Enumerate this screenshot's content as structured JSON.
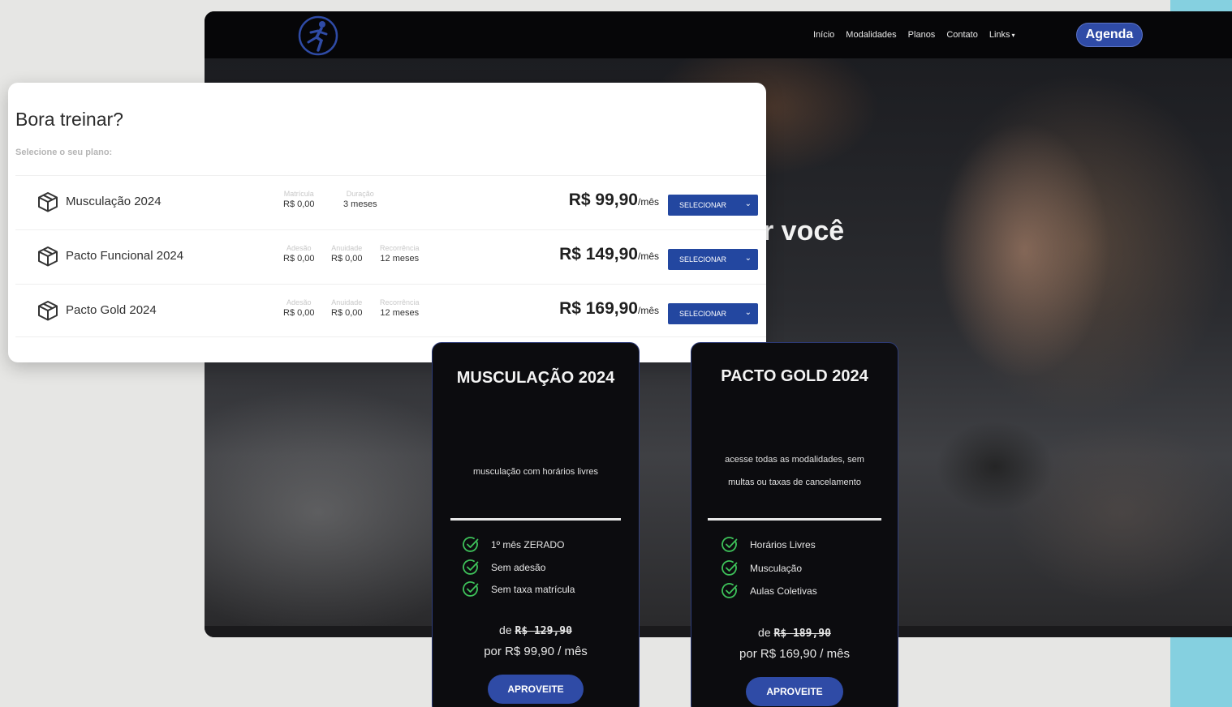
{
  "colors": {
    "brand_blue": "#2f4ba6",
    "select_button": "#2347a0",
    "check_green": "#3ec25a",
    "accent_cyan": "#85d0e0"
  },
  "site": {
    "logo_icon": "runner-logo-icon",
    "nav": [
      "Início",
      "Modalidades",
      "Planos",
      "Contato",
      "Links"
    ],
    "cta": "Agenda",
    "hero_headline": "r você"
  },
  "selector": {
    "title": "Bora treinar?",
    "subtitle": "Selecione o seu plano:",
    "select_label": "SELECIONAR",
    "per_month": "/mês",
    "plans": [
      {
        "name": "Musculação 2024",
        "meta": [
          {
            "label": "Matrícula",
            "value": "R$ 0,00"
          },
          {
            "label": "Duração",
            "value": "3 meses"
          }
        ],
        "price": "R$ 99,90"
      },
      {
        "name": "Pacto Funcional 2024",
        "meta": [
          {
            "label": "Adesão",
            "value": "R$ 0,00"
          },
          {
            "label": "Anuidade",
            "value": "R$ 0,00"
          },
          {
            "label": "Recorrência",
            "value": "12 meses"
          }
        ],
        "price": "R$ 149,90"
      },
      {
        "name": "Pacto Gold 2024",
        "meta": [
          {
            "label": "Adesão",
            "value": "R$ 0,00"
          },
          {
            "label": "Anuidade",
            "value": "R$ 0,00"
          },
          {
            "label": "Recorrência",
            "value": "12 meses"
          }
        ],
        "price": "R$ 169,90"
      }
    ]
  },
  "cards": [
    {
      "title": "MUSCULAÇÃO 2024",
      "desc": [
        "musculação com horários livres"
      ],
      "features": [
        "1º mês ZERADO",
        "Sem adesão",
        "Sem taxa matrícula"
      ],
      "old_prefix": "de",
      "old_price": "R$ 129,90",
      "new_prefix": "por",
      "new_price": "R$ 99,90 / mês",
      "cta": "APROVEITE"
    },
    {
      "title": "PACTO GOLD 2024",
      "desc": [
        "acesse todas as modalidades, sem",
        "multas ou taxas de cancelamento"
      ],
      "features": [
        "Horários Livres",
        "Musculação",
        "Aulas Coletivas"
      ],
      "old_prefix": "de",
      "old_price": "R$ 189,90",
      "new_prefix": "por",
      "new_price": "R$ 169,90 / mês",
      "cta": "APROVEITE"
    }
  ]
}
